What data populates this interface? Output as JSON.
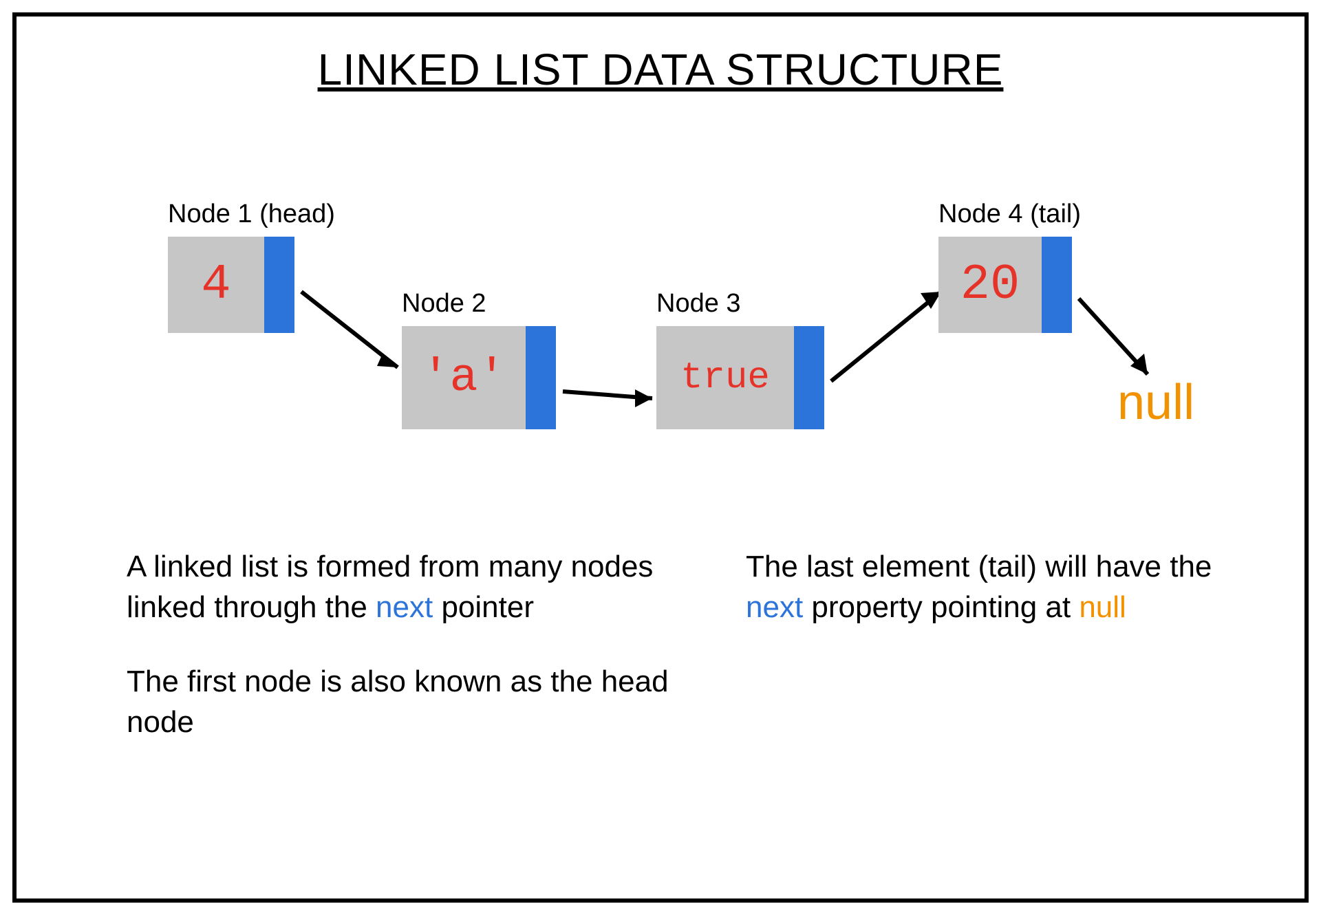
{
  "title": "LINKED LIST DATA STRUCTURE",
  "nodes": [
    {
      "label": "Node 1 (head)",
      "value": "4"
    },
    {
      "label": "Node 2",
      "value": "'a'"
    },
    {
      "label": "Node 3",
      "value": "true"
    },
    {
      "label": "Node 4 (tail)",
      "value": "20"
    }
  ],
  "null_label": "null",
  "colors": {
    "node_bg": "#c6c6c6",
    "pointer_bg": "#2d74da",
    "value_text": "#e6332a",
    "next_text": "#2d74da",
    "null_text": "#f39200"
  },
  "desc_left": {
    "p1_pre": "A linked list is formed from many nodes linked through the ",
    "p1_highlight": "next",
    "p1_post": " pointer",
    "p2": "The first node is also known as the head node"
  },
  "desc_right": {
    "pre": "The last element (tail) will have the ",
    "next_word": "next",
    "mid": " property pointing at ",
    "null_word": "null"
  }
}
